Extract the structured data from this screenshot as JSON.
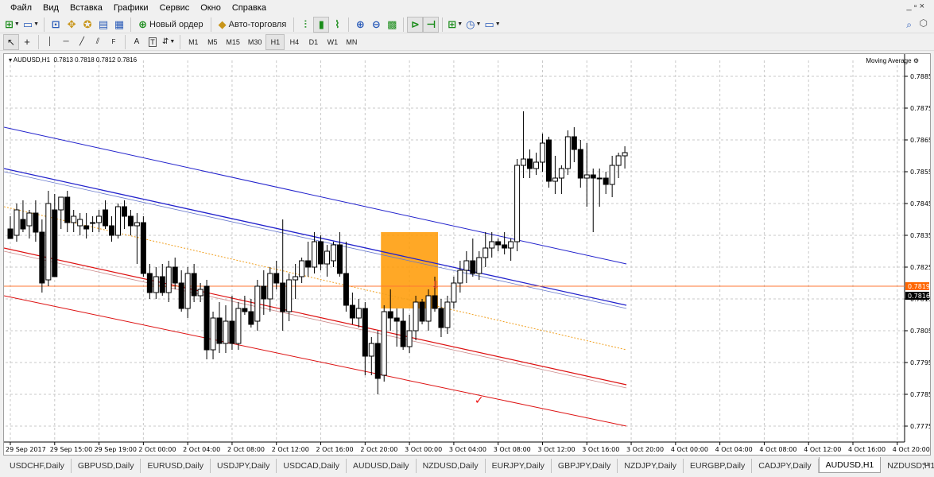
{
  "menu": {
    "items": [
      "Файл",
      "Вид",
      "Вставка",
      "Графики",
      "Сервис",
      "Окно",
      "Справка"
    ],
    "window_controls": "_ ▫ ×"
  },
  "toolbar": {
    "new_order_label": "Новый ордер",
    "auto_trading_label": "Авто-торговля",
    "timeframes": [
      "M1",
      "M5",
      "M15",
      "M30",
      "H1",
      "H4",
      "D1",
      "W1",
      "MN"
    ],
    "active_timeframe": "H1"
  },
  "chart_header": {
    "symbol": "AUDUSD,H1",
    "quote": "0.7813 0.7818 0.7812 0.7816",
    "indicator": "Moving Average"
  },
  "tabs": {
    "items": [
      "USDCHF,Daily",
      "GBPUSD,Daily",
      "EURUSD,Daily",
      "USDJPY,Daily",
      "USDCAD,Daily",
      "AUDUSD,Daily",
      "NZDUSD,Daily",
      "EURJPY,Daily",
      "GBPJPY,Daily",
      "NZDJPY,Daily",
      "EURGBP,Daily",
      "CADJPY,Daily",
      "AUDUSD,H1",
      "NZDUSD,H1"
    ],
    "active": "AUDUSD,H1"
  },
  "colors": {
    "bull": "#ffffff",
    "bear": "#000000",
    "blue_channel": "#2222cc",
    "red_channel": "#dd1111",
    "ma_dotted": "#f0a020",
    "horizontal_level": "#ff7733",
    "highlight_box": "#ff9900",
    "price_label": "#ff6600"
  },
  "chart_data": {
    "type": "candlestick",
    "symbol": "AUDUSD",
    "timeframe": "H1",
    "ylim": [
      0.777,
      0.789
    ],
    "y_ticks": [
      "0.7885",
      "0.7875",
      "0.7865",
      "0.7855",
      "0.7845",
      "0.7835",
      "0.7825",
      "0.7815",
      "0.7805",
      "0.7795",
      "0.7785",
      "0.7775"
    ],
    "x_labels": [
      {
        "i": 0,
        "label": "29 Sep 2017"
      },
      {
        "i": 7,
        "label": "29 Sep 15:00"
      },
      {
        "i": 14,
        "label": "29 Sep 19:00"
      },
      {
        "i": 21,
        "label": "2 Oct 00:00"
      },
      {
        "i": 28,
        "label": "2 Oct 04:00"
      },
      {
        "i": 35,
        "label": "2 Oct 08:00"
      },
      {
        "i": 42,
        "label": "2 Oct 12:00"
      },
      {
        "i": 49,
        "label": "2 Oct 16:00"
      },
      {
        "i": 56,
        "label": "2 Oct 20:00"
      },
      {
        "i": 63,
        "label": "3 Oct 00:00"
      },
      {
        "i": 70,
        "label": "3 Oct 04:00"
      },
      {
        "i": 77,
        "label": "3 Oct 08:00"
      },
      {
        "i": 84,
        "label": "3 Oct 12:00"
      },
      {
        "i": 91,
        "label": "3 Oct 16:00"
      },
      {
        "i": 98,
        "label": "3 Oct 20:00"
      },
      {
        "i": 105,
        "label": "4 Oct 00:00"
      },
      {
        "i": 112,
        "label": "4 Oct 04:00"
      },
      {
        "i": 119,
        "label": "4 Oct 08:00"
      },
      {
        "i": 126,
        "label": "4 Oct 12:00"
      },
      {
        "i": 133,
        "label": "4 Oct 16:00"
      },
      {
        "i": 140,
        "label": "4 Oct 20:00"
      }
    ],
    "candles": [
      [
        0.7837,
        0.7841,
        0.7834,
        0.7834
      ],
      [
        0.7835,
        0.7845,
        0.7833,
        0.7843
      ],
      [
        0.784,
        0.7846,
        0.7836,
        0.7837
      ],
      [
        0.7838,
        0.7843,
        0.7834,
        0.7842
      ],
      [
        0.7842,
        0.7846,
        0.7833,
        0.7836
      ],
      [
        0.7836,
        0.784,
        0.7817,
        0.782
      ],
      [
        0.7821,
        0.7849,
        0.7819,
        0.7845
      ],
      [
        0.7843,
        0.7848,
        0.7822,
        0.7822
      ],
      [
        0.7843,
        0.7846,
        0.7837,
        0.7847
      ],
      [
        0.7847,
        0.7849,
        0.7836,
        0.7839
      ],
      [
        0.7839,
        0.7843,
        0.7836,
        0.7841
      ],
      [
        0.7838,
        0.7842,
        0.7835,
        0.784
      ],
      [
        0.7838,
        0.7842,
        0.7834,
        0.7837
      ],
      [
        0.7839,
        0.7841,
        0.7836,
        0.7839
      ],
      [
        0.7839,
        0.7843,
        0.7836,
        0.7841
      ],
      [
        0.7843,
        0.7846,
        0.7837,
        0.7838
      ],
      [
        0.7838,
        0.7841,
        0.7833,
        0.7835
      ],
      [
        0.7835,
        0.7845,
        0.7834,
        0.7844
      ],
      [
        0.7844,
        0.7846,
        0.7837,
        0.7841
      ],
      [
        0.7841,
        0.7843,
        0.7835,
        0.7838
      ],
      [
        0.7838,
        0.7842,
        0.7826,
        0.7839
      ],
      [
        0.7839,
        0.7841,
        0.7822,
        0.7823
      ],
      [
        0.7823,
        0.7826,
        0.7815,
        0.7817
      ],
      [
        0.7817,
        0.7825,
        0.7815,
        0.7822
      ],
      [
        0.7822,
        0.7826,
        0.7816,
        0.7817
      ],
      [
        0.7817,
        0.7827,
        0.7814,
        0.7825
      ],
      [
        0.7825,
        0.7828,
        0.7818,
        0.782
      ],
      [
        0.782,
        0.7824,
        0.7811,
        0.7812
      ],
      [
        0.7812,
        0.7825,
        0.7809,
        0.7823
      ],
      [
        0.7823,
        0.7826,
        0.7814,
        0.7816
      ],
      [
        0.7816,
        0.782,
        0.7814,
        0.7818
      ],
      [
        0.7819,
        0.7821,
        0.7796,
        0.7799
      ],
      [
        0.7799,
        0.7811,
        0.7796,
        0.7809
      ],
      [
        0.7809,
        0.7814,
        0.7798,
        0.7801
      ],
      [
        0.7801,
        0.7813,
        0.7798,
        0.7808
      ],
      [
        0.7808,
        0.7816,
        0.7799,
        0.7801
      ],
      [
        0.7801,
        0.7814,
        0.7799,
        0.7812
      ],
      [
        0.7812,
        0.7816,
        0.781,
        0.7811
      ],
      [
        0.7811,
        0.7815,
        0.7806,
        0.7807
      ],
      [
        0.7808,
        0.7821,
        0.7805,
        0.7819
      ],
      [
        0.7819,
        0.7824,
        0.781,
        0.7815
      ],
      [
        0.7815,
        0.7825,
        0.7811,
        0.7823
      ],
      [
        0.7823,
        0.7827,
        0.7818,
        0.782
      ],
      [
        0.782,
        0.784,
        0.7805,
        0.7811
      ],
      [
        0.7811,
        0.7823,
        0.7808,
        0.7821
      ],
      [
        0.7821,
        0.7826,
        0.7815,
        0.7822
      ],
      [
        0.7822,
        0.7828,
        0.782,
        0.7827
      ],
      [
        0.7827,
        0.7833,
        0.7822,
        0.7825
      ],
      [
        0.7825,
        0.7836,
        0.7823,
        0.7833
      ],
      [
        0.7833,
        0.7835,
        0.7824,
        0.7826
      ],
      [
        0.7826,
        0.7832,
        0.7822,
        0.783
      ],
      [
        0.7827,
        0.7833,
        0.7825,
        0.7832
      ],
      [
        0.7832,
        0.7836,
        0.7822,
        0.7823
      ],
      [
        0.7823,
        0.7833,
        0.7811,
        0.7813
      ],
      [
        0.7813,
        0.7817,
        0.7807,
        0.7809
      ],
      [
        0.7809,
        0.7815,
        0.7806,
        0.7812
      ],
      [
        0.7812,
        0.7814,
        0.7791,
        0.7797
      ],
      [
        0.7797,
        0.7803,
        0.7791,
        0.7801
      ],
      [
        0.7801,
        0.7805,
        0.7785,
        0.779
      ],
      [
        0.7791,
        0.7813,
        0.7789,
        0.7811
      ],
      [
        0.7811,
        0.7818,
        0.7805,
        0.7809
      ],
      [
        0.7809,
        0.7812,
        0.78,
        0.7808
      ],
      [
        0.7808,
        0.7812,
        0.7799,
        0.78
      ],
      [
        0.78,
        0.781,
        0.7798,
        0.7805
      ],
      [
        0.7805,
        0.7816,
        0.7802,
        0.7814
      ],
      [
        0.7814,
        0.7815,
        0.7807,
        0.7808
      ],
      [
        0.7808,
        0.7818,
        0.7805,
        0.7816
      ],
      [
        0.7816,
        0.7822,
        0.7811,
        0.7812
      ],
      [
        0.7812,
        0.7815,
        0.7803,
        0.7806
      ],
      [
        0.7806,
        0.7816,
        0.7804,
        0.7814
      ],
      [
        0.7814,
        0.7822,
        0.7812,
        0.782
      ],
      [
        0.782,
        0.7827,
        0.7817,
        0.7824
      ],
      [
        0.7824,
        0.783,
        0.782,
        0.7827
      ],
      [
        0.7827,
        0.7834,
        0.7822,
        0.7823
      ],
      [
        0.7823,
        0.783,
        0.7821,
        0.7828
      ],
      [
        0.7828,
        0.7836,
        0.7825,
        0.7831
      ],
      [
        0.7831,
        0.7836,
        0.7828,
        0.7833
      ],
      [
        0.7833,
        0.7834,
        0.783,
        0.7832
      ],
      [
        0.7832,
        0.7836,
        0.7829,
        0.7831
      ],
      [
        0.7831,
        0.7834,
        0.7827,
        0.7833
      ],
      [
        0.7833,
        0.7859,
        0.783,
        0.7857
      ],
      [
        0.7857,
        0.7874,
        0.7853,
        0.7859
      ],
      [
        0.7859,
        0.7862,
        0.7853,
        0.7856
      ],
      [
        0.7856,
        0.7861,
        0.7854,
        0.7858
      ],
      [
        0.7858,
        0.7867,
        0.7855,
        0.7864
      ],
      [
        0.7865,
        0.7866,
        0.785,
        0.7852
      ],
      [
        0.7852,
        0.786,
        0.7848,
        0.7853
      ],
      [
        0.7853,
        0.7857,
        0.7848,
        0.7856
      ],
      [
        0.7856,
        0.7868,
        0.7854,
        0.7866
      ],
      [
        0.7866,
        0.7869,
        0.7858,
        0.7862
      ],
      [
        0.7862,
        0.7865,
        0.785,
        0.7853
      ],
      [
        0.7853,
        0.7864,
        0.7844,
        0.7854
      ],
      [
        0.7854,
        0.7856,
        0.7836,
        0.7853
      ],
      [
        0.7853,
        0.7856,
        0.7844,
        0.7853
      ],
      [
        0.7853,
        0.7855,
        0.7848,
        0.7851
      ],
      [
        0.7851,
        0.786,
        0.7847,
        0.7857
      ],
      [
        0.7857,
        0.7861,
        0.7853,
        0.786
      ],
      [
        0.786,
        0.7863,
        0.7856,
        0.7861
      ]
    ],
    "annotations": {
      "price_labels": [
        "0.7819",
        "0.7816"
      ],
      "horizontal_level": 0.7819,
      "current_price": 0.7816,
      "arrow_down_marker": "⇩",
      "checkmark": "✓"
    }
  }
}
